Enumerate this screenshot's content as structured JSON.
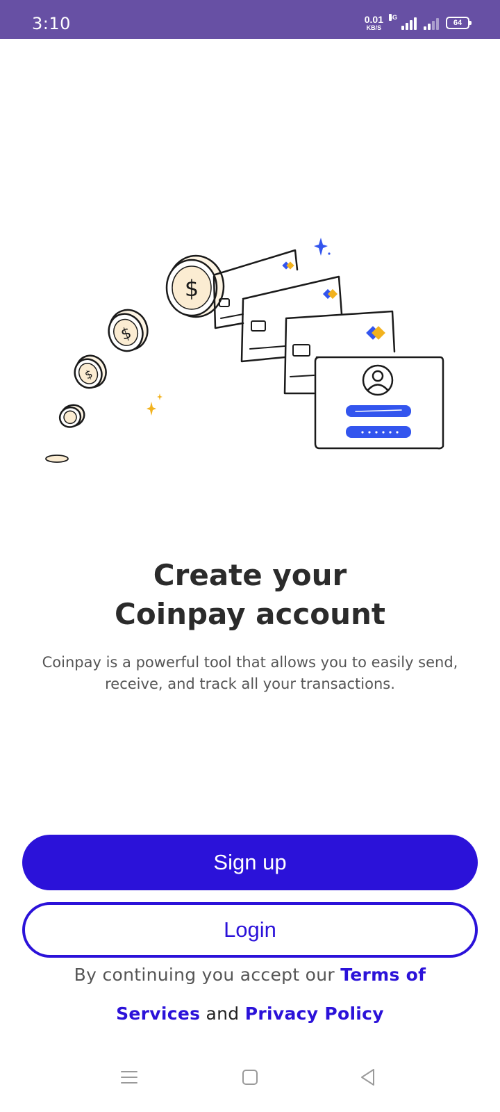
{
  "status_bar": {
    "time": "3:10",
    "net_speed_value": "0.01",
    "net_speed_unit": "KB/S",
    "network_type": "4G",
    "battery_level": "64"
  },
  "illustration": {
    "name": "coins-and-cards-illustration",
    "accent_blue": "#3355ee",
    "accent_yellow": "#f2b21e"
  },
  "onboarding": {
    "title_line1": "Create your",
    "title_line2": "Coinpay account",
    "description": "Coinpay is a powerful tool that allows you to easily send, receive, and track all your transactions."
  },
  "actions": {
    "signup_label": "Sign up",
    "login_label": "Login"
  },
  "legal": {
    "prefix": "By continuing you accept our ",
    "terms_link": "Terms of Services",
    "conjunction": " and ",
    "privacy_link": "Privacy Policy"
  },
  "nav_bar": {
    "items": [
      "menu-icon",
      "home-square-icon",
      "back-triangle-icon"
    ]
  },
  "colors": {
    "status_bar": "#6750a4",
    "primary": "#2b12d9",
    "title_text": "#2b2b2b",
    "body_text": "#555555"
  }
}
